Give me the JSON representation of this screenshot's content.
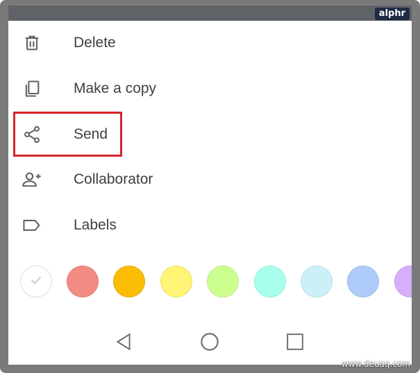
{
  "watermarks": {
    "top": "alphr",
    "bottom": "www.deuaq.com"
  },
  "menu": {
    "items": [
      {
        "id": "delete",
        "label": "Delete",
        "icon": "trash-icon"
      },
      {
        "id": "copy",
        "label": "Make a copy",
        "icon": "copy-icon"
      },
      {
        "id": "send",
        "label": "Send",
        "icon": "share-icon"
      },
      {
        "id": "collaborator",
        "label": "Collaborator",
        "icon": "person-add-icon"
      },
      {
        "id": "labels",
        "label": "Labels",
        "icon": "label-icon"
      }
    ],
    "highlighted": "send",
    "highlight_color": "#d8232a"
  },
  "colors": {
    "swatches": [
      "#ffffff",
      "#f28b82",
      "#fbbc04",
      "#fff475",
      "#ccff90",
      "#a7ffeb",
      "#cbf0f8",
      "#aecbfa",
      "#d7aefb"
    ],
    "selected_index": 0
  },
  "nav": {
    "icons": [
      "back-icon",
      "home-icon",
      "recents-icon"
    ]
  }
}
